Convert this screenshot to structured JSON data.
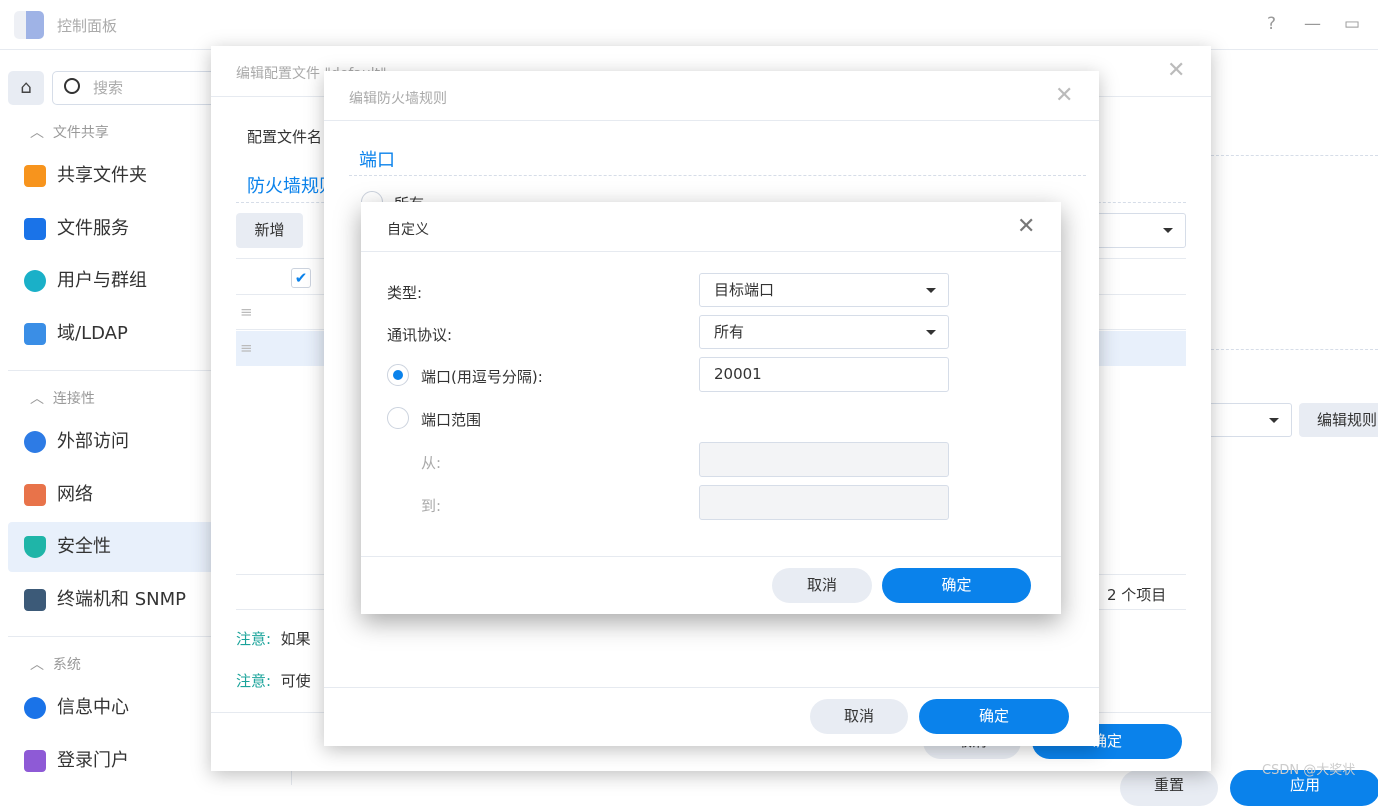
{
  "app": {
    "title": "控制面板",
    "help": "?",
    "minimize": "—",
    "maximize": "▭"
  },
  "sidebar": {
    "search_placeholder": "搜索",
    "sections": [
      {
        "label": "文件共享"
      },
      {
        "label": "连接性"
      },
      {
        "label": "系统"
      }
    ],
    "items": [
      {
        "label": "共享文件夹",
        "color": "#f7941d"
      },
      {
        "label": "文件服务",
        "color": "#1a73e8"
      },
      {
        "label": "用户与群组",
        "color": "#1ab0c8"
      },
      {
        "label": "域/LDAP",
        "color": "#3a8ee6"
      },
      {
        "label": "外部访问",
        "color": "#2d7be5"
      },
      {
        "label": "网络",
        "color": "#e8734a"
      },
      {
        "label": "安全性",
        "color": "#1fb5a8"
      },
      {
        "label": "终端机和 SNMP",
        "color": "#3c5a78"
      },
      {
        "label": "信息中心",
        "color": "#1a73e8"
      },
      {
        "label": "登录门户",
        "color": "#8e5ad6"
      }
    ]
  },
  "background": {
    "edit_rules_button": "编辑规则",
    "reset_button": "重置",
    "apply_button": "应用"
  },
  "profile_dialog": {
    "title": "编辑配置文件 \"default\"",
    "profile_name_label": "配置文件名",
    "rules_heading": "防火墙规则",
    "add_button": "新增",
    "notes": [
      {
        "label": "注意:",
        "text": "如果"
      },
      {
        "label": "注意:",
        "text": "可使"
      }
    ],
    "item_count": "2 个项目",
    "cancel": "取消",
    "ok": "确定"
  },
  "rule_dialog": {
    "title": "编辑防火墙规则",
    "port_heading": "端口",
    "all_option": "所有",
    "cancel": "取消",
    "ok": "确定"
  },
  "custom_dialog": {
    "title": "自定义",
    "type_label": "类型:",
    "type_value": "目标端口",
    "protocol_label": "通讯协议:",
    "protocol_value": "所有",
    "port_option": "端口(用逗号分隔):",
    "port_value": "20001",
    "port_selected": true,
    "range_option": "端口范围",
    "from_label": "从:",
    "to_label": "到:",
    "from_value": "",
    "to_value": "",
    "cancel": "取消",
    "ok": "确定"
  },
  "watermark": "CSDN @大奖状",
  "accent": "#0a82eb"
}
